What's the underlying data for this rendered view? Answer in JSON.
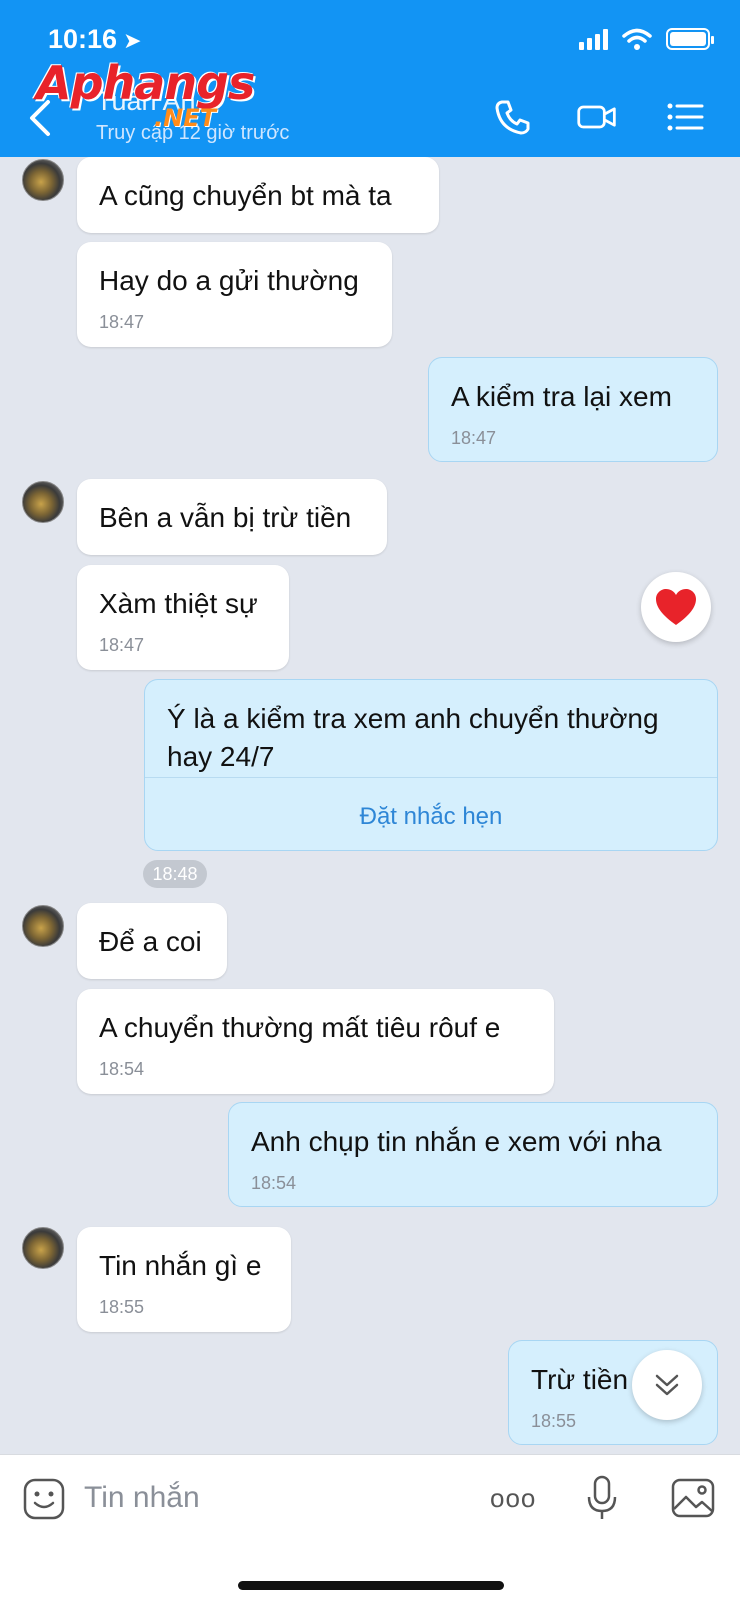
{
  "status_bar": {
    "time": "10:16"
  },
  "header": {
    "watermark_main": "Aphangs",
    "watermark_sub": ".NET",
    "contact_name": "Tuấn An",
    "contact_status": "Truy cập 12 giờ trước"
  },
  "messages": [
    {
      "text": "A cũng chuyển bt mà ta",
      "time": ""
    },
    {
      "text": "Hay do a gửi thường",
      "time": "18:47"
    },
    {
      "text": "A kiểm tra lại xem",
      "time": "18:47"
    },
    {
      "text": "Bên a vẫn bị trừ tiền",
      "time": ""
    },
    {
      "text": "Xàm thiệt sự",
      "time": "18:47"
    },
    {
      "text": "Ý là a kiểm tra xem anh chuyển thường hay 24/7",
      "time": "",
      "action": "Đặt nhắc hẹn"
    },
    {
      "text": "Để a coi",
      "time": ""
    },
    {
      "text": "A chuyển thường mất tiêu rôuf e",
      "time": "18:54"
    },
    {
      "text": "Anh chụp tin nhắn e xem với nha",
      "time": "18:54"
    },
    {
      "text": "Tin nhắn gì e",
      "time": "18:55"
    },
    {
      "text": "Trừ tiền a ik",
      "time": "18:55"
    }
  ],
  "time_pill": "18:48",
  "input": {
    "placeholder": "Tin nhắn",
    "more_label": "ooo"
  },
  "colors": {
    "header": "#1294f4",
    "incoming": "#ffffff",
    "outgoing": "#d5effd",
    "background": "#e2e6ee"
  }
}
